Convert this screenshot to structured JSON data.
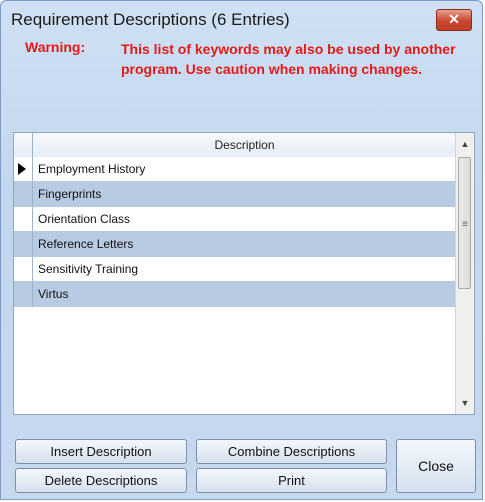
{
  "window": {
    "title": "Requirement Descriptions (6 Entries)",
    "close_glyph": "✕"
  },
  "warning": {
    "label": "Warning:",
    "text": "This list of keywords may also be used by another program. Use caution when making changes."
  },
  "grid": {
    "column_header": "Description",
    "rows": [
      {
        "label": "Employment History",
        "current": true
      },
      {
        "label": "Fingerprints"
      },
      {
        "label": "Orientation Class"
      },
      {
        "label": "Reference Letters"
      },
      {
        "label": "Sensitivity Training"
      },
      {
        "label": "Virtus"
      }
    ],
    "scroll_up_glyph": "▲",
    "scroll_down_glyph": "▼",
    "scroll_grip": "≡"
  },
  "buttons": {
    "insert": "Insert Description",
    "combine": "Combine Descriptions",
    "delete": "Delete Descriptions",
    "print": "Print",
    "close": "Close"
  },
  "colors": {
    "warning": "#e51919",
    "alt_row": "#b8cbe2",
    "window_bg": "#c6d9ef"
  }
}
